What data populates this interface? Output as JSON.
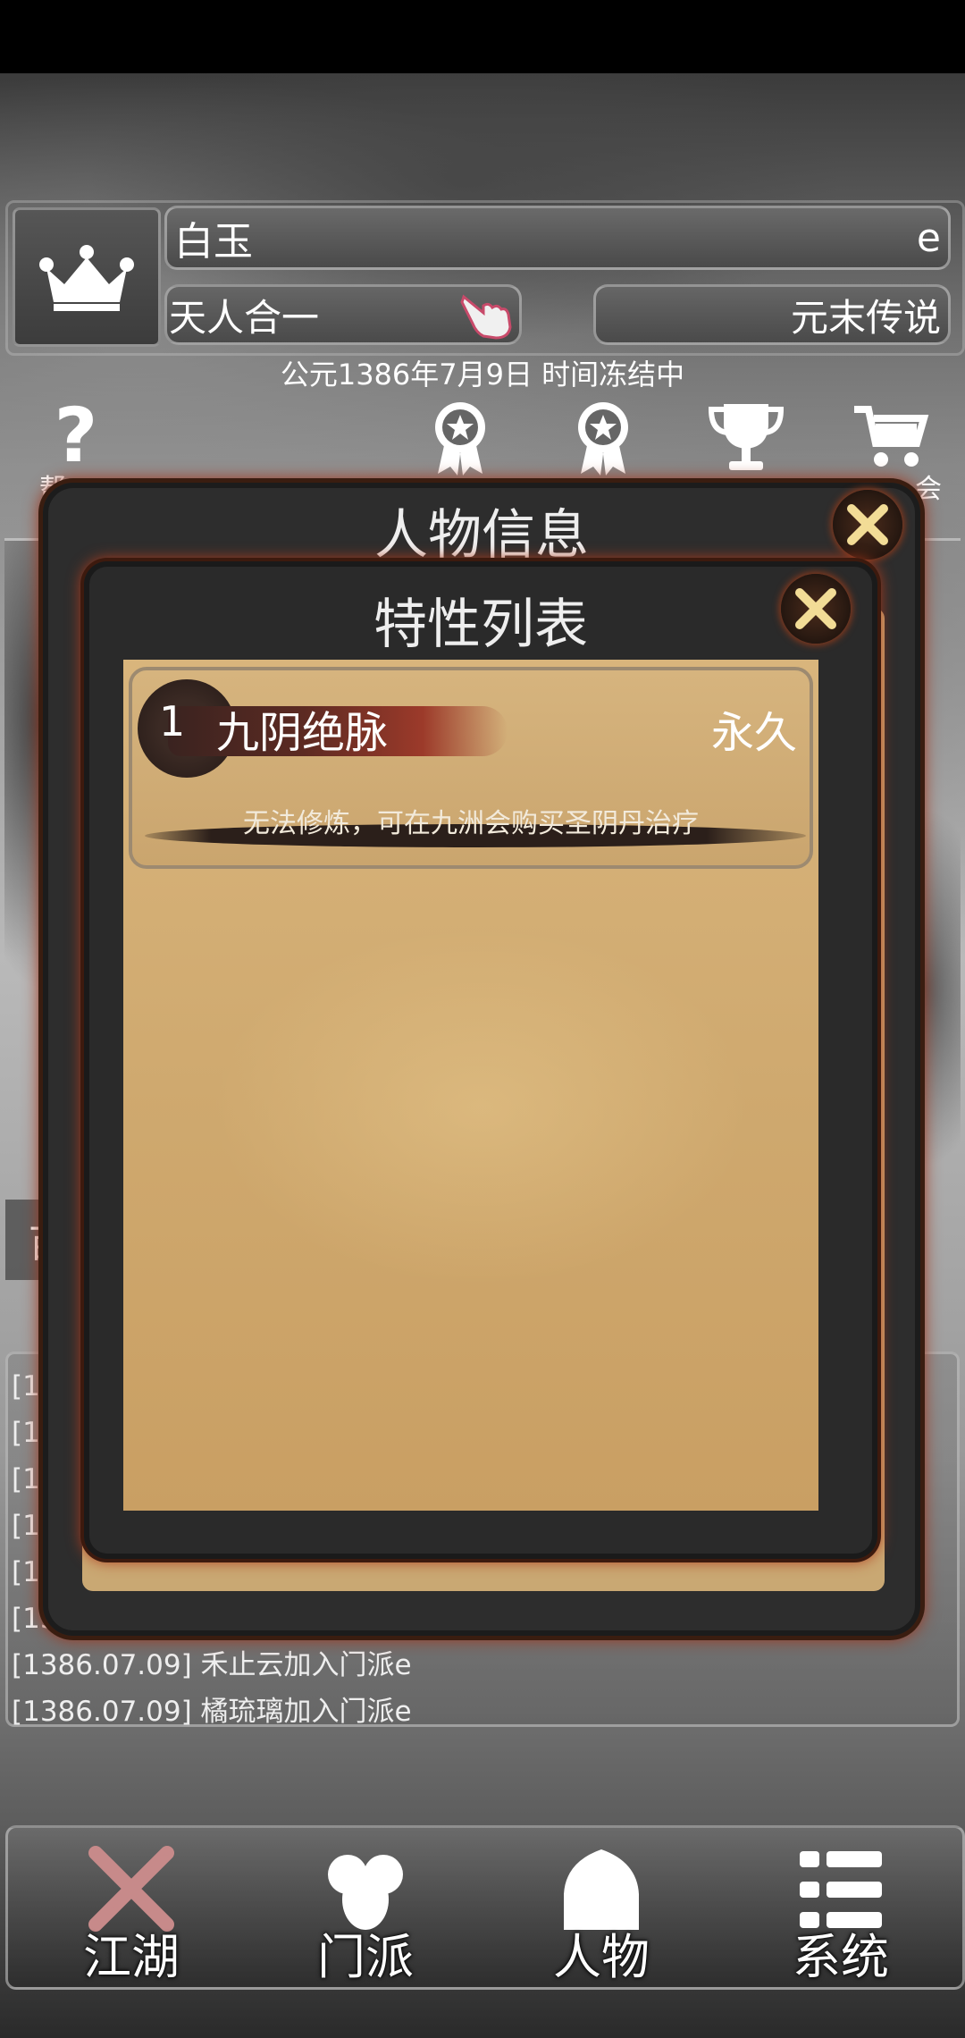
{
  "header": {
    "name": "白玉",
    "name_suffix": "e",
    "realm": "天人合一",
    "title": "元末传说",
    "date_status": "公元1386年7月9日 时间冻结中"
  },
  "top_icons": {
    "help_label_partial": "帮",
    "right_label_partial": "会",
    "icons": [
      "question-icon",
      "ribbon-medal-icon",
      "ribbon-medal-icon",
      "trophy-icon",
      "cart-icon"
    ]
  },
  "side_tab_partial": "苗",
  "log": {
    "lines": [
      "[13",
      "[13",
      "[13",
      "[13",
      "[13",
      "[13",
      "[1386.07.09] 禾止云加入门派e",
      "[1386.07.09] 橘琉璃加入门派e"
    ]
  },
  "dialog_character": {
    "title": "人物信息"
  },
  "dialog_traits": {
    "title": "特性列表",
    "items": [
      {
        "index": "1",
        "name": "九阴绝脉",
        "duration": "永久",
        "description": "无法修炼，可在九洲会购买圣阴丹治疗"
      }
    ]
  },
  "bottom_nav": {
    "items": [
      {
        "label": "江湖",
        "icon": "crossed-swords-icon"
      },
      {
        "label": "门派",
        "icon": "group-icon"
      },
      {
        "label": "人物",
        "icon": "house-icon"
      },
      {
        "label": "系统",
        "icon": "menu-list-icon"
      }
    ]
  },
  "colors": {
    "parchment": "#d4b078",
    "dialog_frame": "#2d2d2d",
    "ember": "#a0331a",
    "close_x": "#f2dc96"
  }
}
